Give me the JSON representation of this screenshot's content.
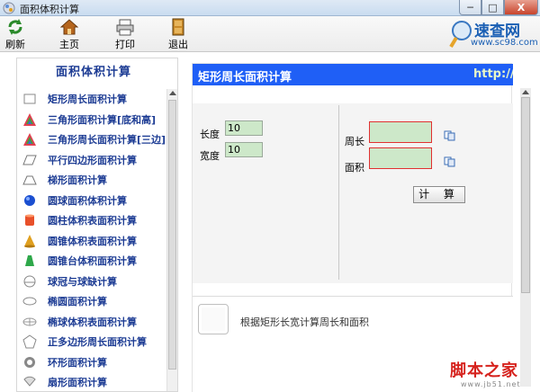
{
  "window": {
    "title": "面积体积计算",
    "min_label": "─",
    "max_label": "□",
    "close_label": "X"
  },
  "toolbar": {
    "refresh_label": "刷新",
    "home_label": "主页",
    "print_label": "打印",
    "exit_label": "退出"
  },
  "logo": {
    "brand": "速查网",
    "url": "www.sc98.com"
  },
  "sidebar": {
    "title": "面积体积计算",
    "items": [
      {
        "label": "矩形周长面积计算",
        "icon": "rectangle-icon"
      },
      {
        "label": "三角形面积计算[底和高]",
        "icon": "triangle-icon"
      },
      {
        "label": "三角形周长面积计算[三边]",
        "icon": "triangle-icon"
      },
      {
        "label": "平行四边形面积计算",
        "icon": "parallelogram-icon"
      },
      {
        "label": "梯形面积计算",
        "icon": "trapezoid-icon"
      },
      {
        "label": "圆球面积体积计算",
        "icon": "sphere-icon"
      },
      {
        "label": "圆柱体积表面积计算",
        "icon": "cylinder-icon"
      },
      {
        "label": "圆锥体积表面积计算",
        "icon": "cone-icon"
      },
      {
        "label": "圆锥台体积面积计算",
        "icon": "frustum-icon"
      },
      {
        "label": "球冠与球缺计算",
        "icon": "spherical-cap-icon"
      },
      {
        "label": "椭圆面积计算",
        "icon": "ellipse-icon"
      },
      {
        "label": "椭球体积表面积计算",
        "icon": "ellipsoid-icon"
      },
      {
        "label": "正多边形周长面积计算",
        "icon": "polygon-icon"
      },
      {
        "label": "环形面积计算",
        "icon": "ring-icon"
      },
      {
        "label": "扇形面积计算",
        "icon": "sector-icon"
      }
    ]
  },
  "main": {
    "header_title": "矩形周长面积计算",
    "header_url": "http://w",
    "length_label": "长度",
    "length_value": "10",
    "width_label": "宽度",
    "width_value": "10",
    "perimeter_label": "周长",
    "perimeter_value": "",
    "area_label": "面积",
    "area_value": "",
    "calc_button": "计 算",
    "description": "根据矩形长宽计算周长和面积"
  },
  "watermark": {
    "main": "脚本之家",
    "sub": "www.jb51.net"
  },
  "colors": {
    "accent": "#1f5ff6",
    "sidebar_text": "#1d3c94",
    "field_bg": "#cde8c9",
    "result_border": "#e03030"
  }
}
